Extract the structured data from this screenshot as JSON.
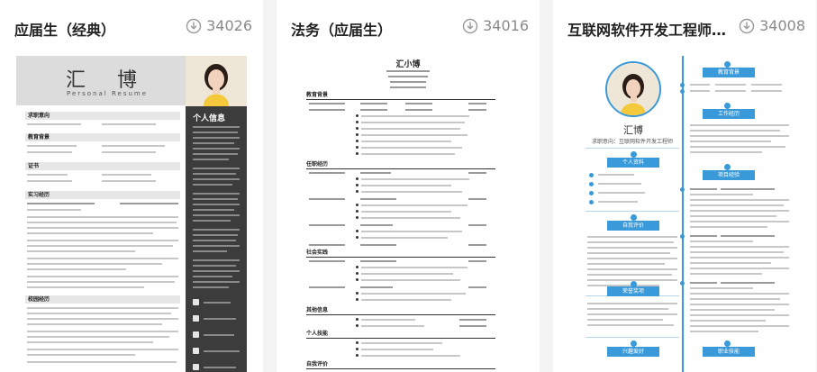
{
  "cards": [
    {
      "title": "应届生（经典）",
      "downloads": "34026",
      "preview": {
        "name": "汇 博",
        "name_en": "Personal Resume",
        "sidebar_title": "个人信息",
        "sections": [
          "求职意向",
          "教育背景",
          "证书",
          "实习经历",
          "校园经历"
        ]
      }
    },
    {
      "title": "法务（应届生）",
      "downloads": "34016",
      "preview": {
        "name": "汇小博",
        "sections": [
          "教育背景",
          "任职经历",
          "社会实践",
          "其他信息",
          "个人技能",
          "自我评价"
        ]
      }
    },
    {
      "title": "互联网软件开发工程师（应...",
      "downloads": "34008",
      "preview": {
        "name": "汇博",
        "subtitle": "求职意向：互联网软件开发工程师",
        "left_tags": [
          "个人资料",
          "自我评价",
          "荣誉奖项",
          "兴趣爱好"
        ],
        "right_tags": [
          "教育背景",
          "工作经历",
          "项目经验",
          "职业技能"
        ]
      }
    }
  ],
  "colors": {
    "page_bg": "#f3f3f3",
    "card_bg": "#ffffff",
    "title_text": "#222222",
    "download_text": "#8a8a8a",
    "resume3_accent": "#3a9ad9",
    "resume1_sidebar": "#3c3c3c"
  },
  "icons": {
    "download": "download-circle-arrow-icon"
  }
}
